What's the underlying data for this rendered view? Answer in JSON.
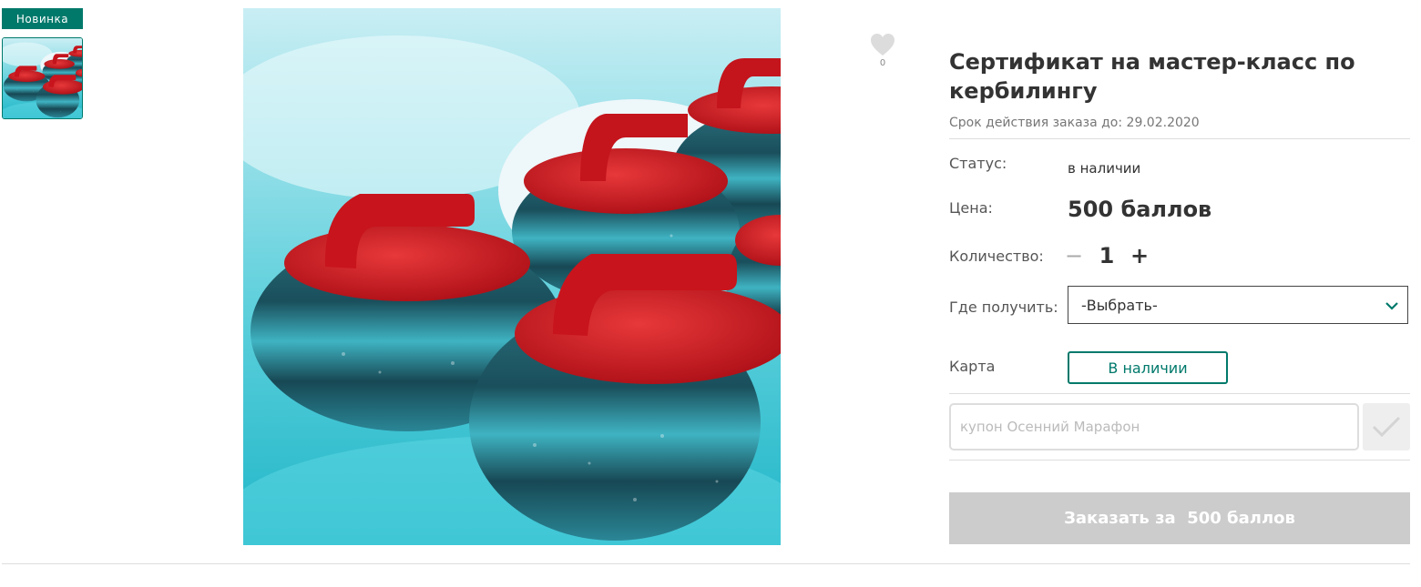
{
  "badge": {
    "label": "Новинка",
    "color": "#00796b"
  },
  "gallery": {
    "image_subject": "red-handled curling stones on ice",
    "accent_color": "#00796b"
  },
  "favorite": {
    "icon": "heart-icon",
    "count": "0"
  },
  "product": {
    "title": "Сертификат на мастер-класс по кербилингу",
    "validity": "Срок действия заказа до: 29.02.2020"
  },
  "details": {
    "status_label": "Статус:",
    "status_value": "в наличии",
    "price_label": "Цена:",
    "price_value": "500 баллов",
    "quantity_label": "Количество:",
    "quantity_minus": "−",
    "quantity_value": "1",
    "quantity_plus": "+",
    "pickup_label": "Где получить:",
    "pickup_selected": "-Выбрать-",
    "map_label": "Карта",
    "map_button": "В наличии"
  },
  "coupon": {
    "placeholder": "купон Осенний Марафон",
    "apply_icon": "checkmark-icon"
  },
  "order": {
    "button_label": "Заказать за  500 баллов",
    "button_color": "#cccccc"
  }
}
